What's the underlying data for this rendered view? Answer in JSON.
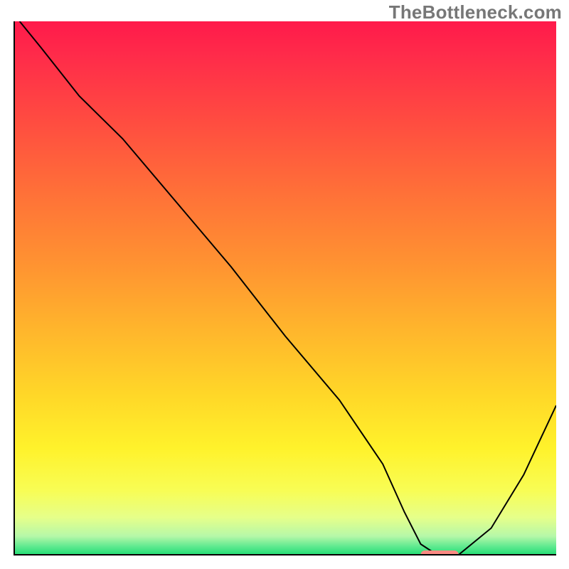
{
  "watermark": "TheBottleneck.com",
  "chart_data": {
    "type": "line",
    "title": "",
    "xlabel": "",
    "ylabel": "",
    "xlim": [
      0,
      100
    ],
    "ylim": [
      0,
      100
    ],
    "x": [
      1,
      5,
      12,
      20,
      30,
      40,
      50,
      60,
      68,
      72,
      75,
      78,
      82,
      88,
      94,
      100
    ],
    "values": [
      100,
      95,
      86,
      78,
      66,
      54,
      41,
      29,
      17,
      8,
      2,
      0,
      0,
      5,
      15,
      28
    ],
    "marker": {
      "x_start": 75,
      "x_end": 82,
      "y": 0
    },
    "gradient_stops": [
      {
        "offset": 0.0,
        "color": "#ff1a4b"
      },
      {
        "offset": 0.06,
        "color": "#ff2a4a"
      },
      {
        "offset": 0.18,
        "color": "#ff4a41"
      },
      {
        "offset": 0.32,
        "color": "#ff7038"
      },
      {
        "offset": 0.46,
        "color": "#ff9431"
      },
      {
        "offset": 0.58,
        "color": "#ffb62c"
      },
      {
        "offset": 0.7,
        "color": "#ffd728"
      },
      {
        "offset": 0.8,
        "color": "#fff22b"
      },
      {
        "offset": 0.88,
        "color": "#f8fd55"
      },
      {
        "offset": 0.93,
        "color": "#e6ff8a"
      },
      {
        "offset": 0.965,
        "color": "#b6f8a8"
      },
      {
        "offset": 0.985,
        "color": "#5de98f"
      },
      {
        "offset": 1.0,
        "color": "#23dd74"
      }
    ]
  }
}
